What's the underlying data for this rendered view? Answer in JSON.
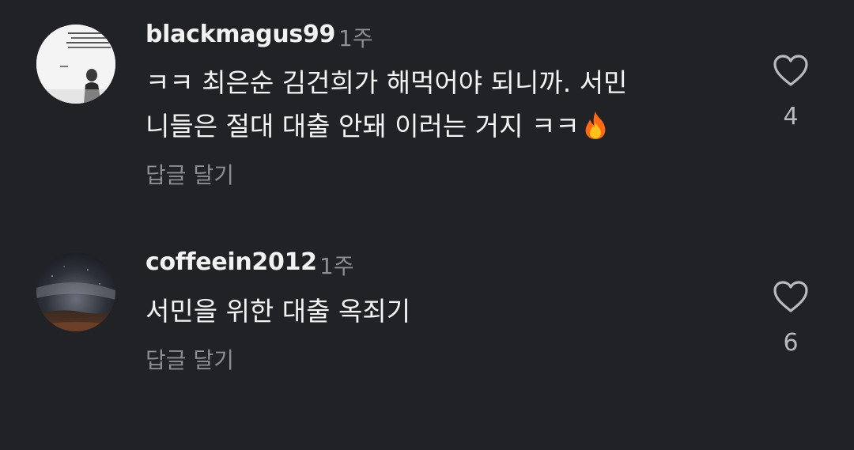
{
  "comments": [
    {
      "username": "blackmagus99",
      "time": "1주",
      "line1": "ㅋㅋ 최은순 김건희가 해먹어야 되니까. 서민",
      "line2": "니들은 절대 대출 안돼 이러는 거지 ㅋㅋ",
      "emoji_icon": "fire-emoji",
      "reply_label": "답글 달기",
      "like_count": "4"
    },
    {
      "username": "coffeein2012",
      "time": "1주",
      "line1": "서민을 위한 대출 옥죄기",
      "reply_label": "답글 달기",
      "like_count": "6"
    }
  ],
  "colors": {
    "background": "#212226",
    "text": "#f4f4f4",
    "muted": "#8d8e92",
    "heart_outline": "#b9babd",
    "fire": "#ff7a1a"
  }
}
